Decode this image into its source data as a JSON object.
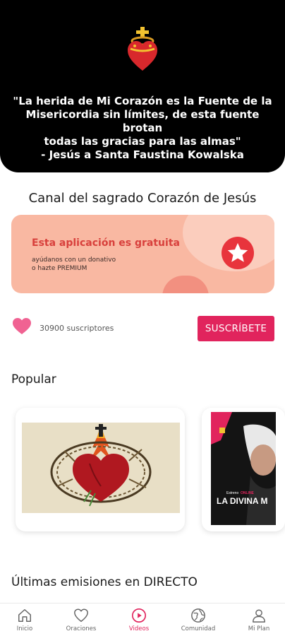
{
  "hero": {
    "quote_lines": [
      "\"La herida de Mi Corazón es la Fuente de la",
      "Misericordia sin límites, de esta fuente brotan",
      "todas las gracias para las almas\"",
      "- Jesús a Santa Faustina Kowalska"
    ],
    "logo_icon": "sacred-heart-icon"
  },
  "channel": {
    "title": "Canal del sagrado Corazón de Jesús"
  },
  "promo": {
    "title": "Esta aplicación es gratuita",
    "subtitle_lines": [
      "ayúdanos con un donativo",
      "o hazte PREMIUM"
    ],
    "icon": "star-icon",
    "colors": {
      "background": "#f9b8a2",
      "title": "#d8403c",
      "star_circle": "#e8343c"
    }
  },
  "subscribers": {
    "count_text": "30900 suscriptores",
    "button_label": "SUSCRÍBETE",
    "icon": "heart-icon",
    "colors": {
      "button": "#e1245d",
      "heart": "#f06292"
    }
  },
  "popular": {
    "title": "Popular",
    "cards": [
      {
        "thumbnail": "sacred-heart-crown-of-thorns-image"
      },
      {
        "thumbnail": "divina-misericordia-video-image",
        "text_small": "Estreno",
        "text_highlight": "ONLINE",
        "text_large": "LA DIVINA M"
      }
    ]
  },
  "live": {
    "title": "Últimas emisiones en DIRECTO"
  },
  "nav": {
    "active_color": "#e1245d",
    "items": [
      {
        "label": "Inicio",
        "icon": "home-icon"
      },
      {
        "label": "Oraciones",
        "icon": "heart-outline-icon"
      },
      {
        "label": "Videos",
        "icon": "play-circle-icon",
        "active": true
      },
      {
        "label": "Comunidad",
        "icon": "globe-icon"
      },
      {
        "label": "Mi Plan",
        "icon": "person-icon"
      }
    ]
  }
}
